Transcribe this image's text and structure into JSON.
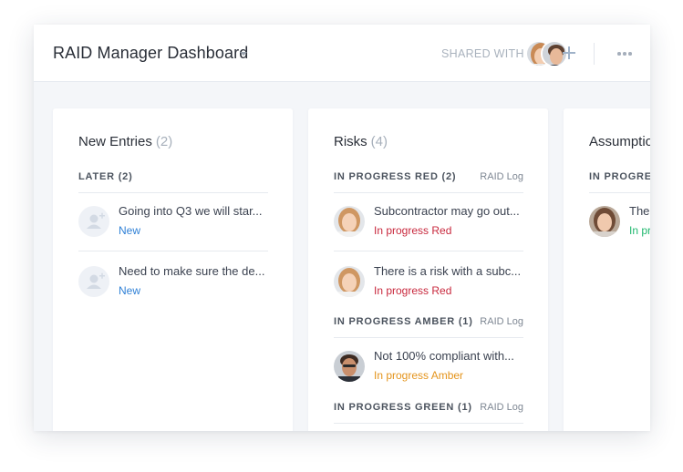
{
  "header": {
    "title": "RAID Manager Dashboard",
    "shared_label": "SHARED WITH",
    "avatars": [
      "woman-avatar",
      "man-avatar"
    ]
  },
  "colors": {
    "new": "#2f80d6",
    "red": "#c8283d",
    "amber": "#e4941c",
    "green": "#21b86f"
  },
  "columns": [
    {
      "title": "New Entries",
      "count": "(2)",
      "groups": [
        {
          "label": "LATER (2)",
          "source": "",
          "cards": [
            {
              "text": "Going into Q3 we will star...",
              "status": "New",
              "avatar": "placeholder-user-icon"
            },
            {
              "text": "Need to make sure the de...",
              "status": "New",
              "avatar": "placeholder-user-icon"
            }
          ]
        }
      ]
    },
    {
      "title": "Risks",
      "count": "(4)",
      "groups": [
        {
          "label": "IN PROGRESS RED (2)",
          "source": "RAID Log",
          "cards": [
            {
              "text": "Subcontractor may go out...",
              "status": "In progress Red",
              "avatar": "woman-avatar"
            },
            {
              "text": "There is a risk with a subc...",
              "status": "In progress Red",
              "avatar": "woman-avatar"
            }
          ]
        },
        {
          "label": "IN PROGRESS AMBER (1)",
          "source": "RAID Log",
          "cards": [
            {
              "text": "Not 100% compliant with...",
              "status": "In progress Amber",
              "avatar": "man-avatar"
            }
          ]
        },
        {
          "label": "IN PROGRESS GREEN (1)",
          "source": "RAID Log",
          "cards": []
        }
      ]
    },
    {
      "title": "Assumptio",
      "count": "",
      "groups": [
        {
          "label": "IN PROGRESS",
          "source": "",
          "cards": [
            {
              "text": "The",
              "status": "In pr",
              "avatar": "woman2-avatar"
            }
          ]
        }
      ]
    }
  ]
}
